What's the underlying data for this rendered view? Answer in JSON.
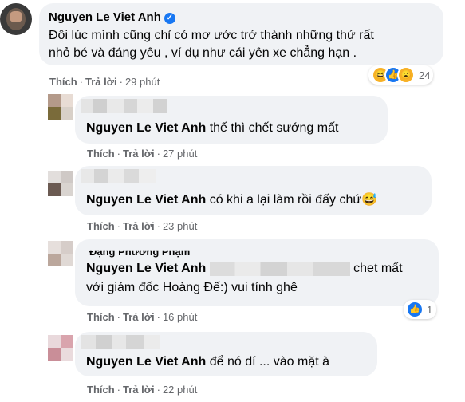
{
  "comments": [
    {
      "author": "Nguyen Le Viet Anh",
      "text_line1": "Đôi lúc mình cũng chỉ có mơ ước trở thành những thứ rất",
      "text_line2": "nhỏ bé và đáng yêu , ví dụ như cái yên xe chẳng hạn .",
      "like": "Thích",
      "reply": "Trả lời",
      "time": "29 phút",
      "reaction_count": "24"
    }
  ],
  "replies": [
    {
      "tag": "Nguyen Le Viet Anh",
      "text": "thế thì chết sướng mất",
      "like": "Thích",
      "reply": "Trả lời",
      "time": "27 phút"
    },
    {
      "tag": "Nguyen Le Viet Anh",
      "text": "có khi a lại làm rồi đấy chứ😅",
      "like": "Thích",
      "reply": "Trả lời",
      "time": "23 phút"
    },
    {
      "partial_name": "Đặng Phương Phạm",
      "tag": "Nguyen Le Viet Anh",
      "text_line1_tail": "chet mất",
      "text_line2": "với giám đốc Hoàng Đế:) vui tính ghê",
      "like": "Thích",
      "reply": "Trả lời",
      "time": "16 phút",
      "reaction_count": "1"
    },
    {
      "tag": "Nguyen Le Viet Anh",
      "text": "để nó dí ... vào mặt à",
      "like": "Thích",
      "reply": "Trả lời",
      "time": "22 phút"
    }
  ],
  "icons": {
    "verified": "verified-badge-icon",
    "reactions": [
      "haha-icon",
      "like-icon",
      "wow-icon"
    ]
  },
  "colors": {
    "bubble": "#f0f2f5",
    "meta_text": "#65676b",
    "accent_blue": "#1877f2"
  }
}
